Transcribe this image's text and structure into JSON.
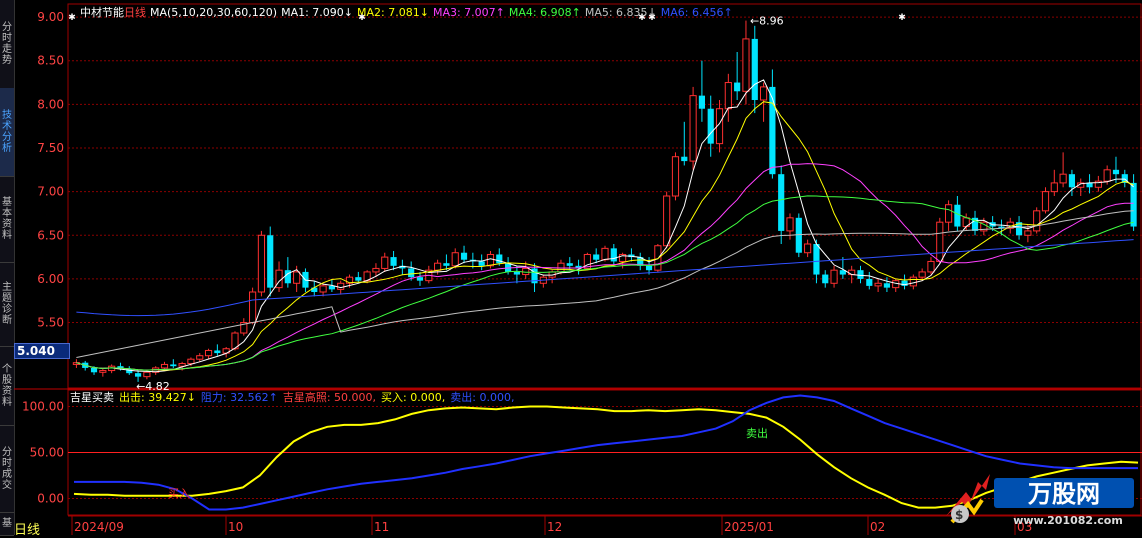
{
  "sidebar": {
    "tabs": [
      {
        "label": "分时走势",
        "active": false
      },
      {
        "label": "技术分析",
        "active": true
      },
      {
        "label": "基本资料",
        "active": false
      },
      {
        "label": "主题诊断",
        "active": false
      },
      {
        "label": "个股资料",
        "active": false
      },
      {
        "label": "分时成交",
        "active": false
      },
      {
        "label": "基",
        "active": false
      }
    ]
  },
  "header": {
    "stock_name": "中材节能",
    "period": "日线",
    "ma_params": "MA(5,10,20,30,60,120)",
    "mas": [
      {
        "label": "MA1:",
        "value": "7.090",
        "arrow": "↓",
        "color": "#ffffff"
      },
      {
        "label": "MA2:",
        "value": "7.081",
        "arrow": "↓",
        "color": "#ffff00"
      },
      {
        "label": "MA3:",
        "value": "7.007",
        "arrow": "↑",
        "color": "#ff40ff"
      },
      {
        "label": "MA4:",
        "value": "6.908",
        "arrow": "↑",
        "color": "#40ff40"
      },
      {
        "label": "MA5:",
        "value": "6.835",
        "arrow": "↓",
        "color": "#c0c0c0"
      },
      {
        "label": "MA6:",
        "value": "6.456",
        "arrow": "↑",
        "color": "#3050ff"
      }
    ]
  },
  "price_axis": {
    "ticks": [
      "9.00",
      "8.50",
      "8.00",
      "7.50",
      "7.00",
      "6.50",
      "6.00",
      "5.50"
    ],
    "current_price": "5.040"
  },
  "annotations": {
    "high": "8.96",
    "low": "4.82"
  },
  "indicator": {
    "name": "吉星买卖",
    "fields": [
      {
        "label": "出击:",
        "value": "39.427",
        "arrow": "↓",
        "color": "#ffff00"
      },
      {
        "label": "阻力:",
        "value": "32.562",
        "arrow": "↑",
        "color": "#3050ff"
      },
      {
        "label": "吉星高照:",
        "value": "50.000,",
        "arrow": "",
        "color": "#ff4040"
      },
      {
        "label": "买入:",
        "value": "0.000,",
        "arrow": "",
        "color": "#ffff00"
      },
      {
        "label": "卖出:",
        "value": "0.000,",
        "arrow": "",
        "color": "#3050ff"
      }
    ],
    "ticks": [
      "100.00",
      "50.00",
      "0.00"
    ],
    "buy_label": "买入",
    "sell_label": "卖出"
  },
  "time_axis": {
    "labels": [
      "2024/09",
      "10",
      "11",
      "12",
      "2025/01",
      "02",
      "03"
    ]
  },
  "bottom_tab": "日线",
  "watermark": {
    "brand": "万股网",
    "url": "www.201082.com"
  },
  "colors": {
    "up": "#ff3030",
    "down": "#00e5ff",
    "grid": "#8b0000"
  },
  "chart_data": {
    "type": "candlestick",
    "price_range": [
      4.75,
      9.15
    ],
    "candles": [
      [
        5.02,
        5.08,
        4.98,
        5.04
      ],
      [
        5.04,
        5.06,
        4.95,
        4.98
      ],
      [
        4.98,
        5.0,
        4.9,
        4.93
      ],
      [
        4.93,
        4.97,
        4.88,
        4.95
      ],
      [
        4.95,
        5.02,
        4.92,
        5.0
      ],
      [
        5.0,
        5.04,
        4.95,
        4.97
      ],
      [
        4.97,
        5.0,
        4.9,
        4.92
      ],
      [
        4.92,
        4.95,
        4.82,
        4.88
      ],
      [
        4.88,
        4.95,
        4.85,
        4.93
      ],
      [
        4.93,
        5.0,
        4.9,
        4.98
      ],
      [
        4.98,
        5.05,
        4.95,
        5.02
      ],
      [
        5.02,
        5.08,
        4.98,
        5.0
      ],
      [
        5.0,
        5.05,
        4.95,
        5.03
      ],
      [
        5.03,
        5.1,
        5.0,
        5.08
      ],
      [
        5.08,
        5.15,
        5.05,
        5.12
      ],
      [
        5.12,
        5.2,
        5.08,
        5.18
      ],
      [
        5.18,
        5.25,
        5.12,
        5.15
      ],
      [
        5.15,
        5.22,
        5.1,
        5.2
      ],
      [
        5.2,
        5.4,
        5.18,
        5.38
      ],
      [
        5.38,
        5.55,
        5.35,
        5.5
      ],
      [
        5.5,
        5.9,
        5.48,
        5.85
      ],
      [
        5.85,
        6.55,
        5.8,
        6.5
      ],
      [
        6.5,
        6.6,
        5.8,
        5.9
      ],
      [
        5.9,
        6.2,
        5.85,
        6.1
      ],
      [
        6.1,
        6.25,
        5.9,
        5.95
      ],
      [
        5.95,
        6.15,
        5.85,
        6.08
      ],
      [
        6.08,
        6.12,
        5.85,
        5.9
      ],
      [
        5.9,
        5.98,
        5.8,
        5.85
      ],
      [
        5.85,
        5.95,
        5.8,
        5.92
      ],
      [
        5.92,
        6.0,
        5.85,
        5.88
      ],
      [
        5.88,
        5.98,
        5.82,
        5.95
      ],
      [
        5.95,
        6.05,
        5.9,
        6.02
      ],
      [
        6.02,
        6.08,
        5.95,
        5.98
      ],
      [
        5.98,
        6.1,
        5.95,
        6.08
      ],
      [
        6.08,
        6.18,
        6.02,
        6.12
      ],
      [
        6.12,
        6.3,
        6.08,
        6.25
      ],
      [
        6.25,
        6.32,
        6.1,
        6.15
      ],
      [
        6.15,
        6.22,
        6.05,
        6.12
      ],
      [
        6.12,
        6.2,
        5.98,
        6.02
      ],
      [
        6.02,
        6.08,
        5.92,
        5.98
      ],
      [
        5.98,
        6.15,
        5.95,
        6.1
      ],
      [
        6.1,
        6.22,
        6.05,
        6.18
      ],
      [
        6.18,
        6.28,
        6.1,
        6.15
      ],
      [
        6.15,
        6.35,
        6.12,
        6.3
      ],
      [
        6.3,
        6.38,
        6.18,
        6.22
      ],
      [
        6.22,
        6.3,
        6.12,
        6.2
      ],
      [
        6.2,
        6.28,
        6.1,
        6.15
      ],
      [
        6.15,
        6.32,
        6.12,
        6.28
      ],
      [
        6.28,
        6.35,
        6.15,
        6.18
      ],
      [
        6.18,
        6.25,
        6.05,
        6.08
      ],
      [
        6.08,
        6.15,
        5.95,
        6.05
      ],
      [
        6.05,
        6.2,
        6.0,
        6.12
      ],
      [
        6.12,
        6.18,
        5.85,
        5.95
      ],
      [
        5.95,
        6.05,
        5.9,
        6.02
      ],
      [
        6.02,
        6.1,
        5.95,
        6.08
      ],
      [
        6.08,
        6.22,
        6.05,
        6.18
      ],
      [
        6.18,
        6.25,
        6.1,
        6.15
      ],
      [
        6.15,
        6.22,
        6.05,
        6.12
      ],
      [
        6.12,
        6.3,
        6.1,
        6.28
      ],
      [
        6.28,
        6.35,
        6.18,
        6.22
      ],
      [
        6.22,
        6.38,
        6.2,
        6.35
      ],
      [
        6.35,
        6.4,
        6.15,
        6.2
      ],
      [
        6.2,
        6.3,
        6.12,
        6.28
      ],
      [
        6.28,
        6.35,
        6.2,
        6.25
      ],
      [
        6.25,
        6.3,
        6.1,
        6.15
      ],
      [
        6.15,
        6.25,
        6.05,
        6.1
      ],
      [
        6.1,
        6.4,
        6.08,
        6.38
      ],
      [
        6.38,
        7.0,
        6.35,
        6.95
      ],
      [
        6.95,
        7.45,
        6.9,
        7.4
      ],
      [
        7.4,
        7.8,
        7.3,
        7.35
      ],
      [
        7.35,
        8.2,
        7.25,
        8.1
      ],
      [
        8.1,
        8.5,
        7.8,
        7.95
      ],
      [
        7.95,
        8.1,
        7.4,
        7.55
      ],
      [
        7.55,
        8.05,
        7.45,
        7.95
      ],
      [
        7.95,
        8.35,
        7.8,
        8.25
      ],
      [
        8.25,
        8.6,
        8.05,
        8.15
      ],
      [
        8.15,
        8.96,
        8.0,
        8.75
      ],
      [
        8.75,
        8.9,
        7.9,
        8.05
      ],
      [
        8.05,
        8.25,
        7.8,
        8.2
      ],
      [
        8.2,
        8.4,
        7.15,
        7.2
      ],
      [
        7.2,
        7.3,
        6.4,
        6.55
      ],
      [
        6.55,
        6.75,
        6.45,
        6.7
      ],
      [
        6.7,
        6.75,
        6.25,
        6.3
      ],
      [
        6.3,
        6.45,
        6.25,
        6.4
      ],
      [
        6.4,
        6.45,
        5.95,
        6.05
      ],
      [
        6.05,
        6.1,
        5.9,
        5.95
      ],
      [
        5.95,
        6.15,
        5.9,
        6.1
      ],
      [
        6.1,
        6.25,
        6.0,
        6.05
      ],
      [
        6.05,
        6.15,
        5.95,
        6.1
      ],
      [
        6.1,
        6.15,
        5.95,
        6.0
      ],
      [
        6.0,
        6.08,
        5.88,
        5.92
      ],
      [
        5.92,
        6.0,
        5.85,
        5.95
      ],
      [
        5.95,
        6.02,
        5.85,
        5.9
      ],
      [
        5.9,
        6.0,
        5.85,
        5.98
      ],
      [
        5.98,
        6.05,
        5.88,
        5.92
      ],
      [
        5.92,
        6.05,
        5.88,
        6.02
      ],
      [
        6.02,
        6.12,
        5.98,
        6.08
      ],
      [
        6.08,
        6.25,
        6.05,
        6.2
      ],
      [
        6.2,
        6.7,
        6.18,
        6.65
      ],
      [
        6.65,
        6.9,
        6.55,
        6.85
      ],
      [
        6.85,
        6.95,
        6.55,
        6.6
      ],
      [
        6.6,
        6.75,
        6.55,
        6.7
      ],
      [
        6.7,
        6.78,
        6.5,
        6.55
      ],
      [
        6.55,
        6.7,
        6.5,
        6.65
      ],
      [
        6.65,
        6.72,
        6.55,
        6.6
      ],
      [
        6.6,
        6.68,
        6.5,
        6.58
      ],
      [
        6.58,
        6.7,
        6.52,
        6.65
      ],
      [
        6.65,
        6.72,
        6.45,
        6.5
      ],
      [
        6.5,
        6.62,
        6.42,
        6.55
      ],
      [
        6.55,
        6.82,
        6.52,
        6.78
      ],
      [
        6.78,
        7.05,
        6.75,
        7.0
      ],
      [
        7.0,
        7.25,
        6.95,
        7.1
      ],
      [
        7.1,
        7.45,
        7.05,
        7.2
      ],
      [
        7.2,
        7.25,
        6.95,
        7.05
      ],
      [
        7.05,
        7.15,
        6.95,
        7.1
      ],
      [
        7.1,
        7.2,
        6.98,
        7.05
      ],
      [
        7.05,
        7.18,
        7.0,
        7.12
      ],
      [
        7.12,
        7.3,
        7.08,
        7.25
      ],
      [
        7.25,
        7.4,
        7.1,
        7.2
      ],
      [
        7.2,
        7.25,
        7.05,
        7.1
      ],
      [
        7.1,
        7.2,
        6.55,
        6.6
      ]
    ],
    "indicator_range": [
      -18,
      118
    ],
    "attack": [
      5,
      4,
      4,
      3,
      3,
      3,
      3,
      3,
      5,
      8,
      12,
      25,
      45,
      62,
      72,
      78,
      80,
      80,
      82,
      86,
      92,
      96,
      98,
      99,
      98,
      97,
      99,
      100,
      100,
      99,
      98,
      97,
      95,
      95,
      96,
      95,
      96,
      97,
      96,
      94,
      92,
      88,
      78,
      64,
      48,
      34,
      22,
      12,
      4,
      -5,
      -10,
      -10,
      -8,
      -2,
      6,
      12,
      18,
      24,
      28,
      32,
      36,
      38,
      40,
      39
    ],
    "resist": [
      18,
      18,
      18,
      18,
      17,
      15,
      10,
      0,
      -12,
      -12,
      -10,
      -6,
      -2,
      2,
      6,
      10,
      13,
      16,
      18,
      20,
      22,
      25,
      28,
      32,
      35,
      38,
      42,
      46,
      49,
      52,
      55,
      58,
      60,
      62,
      64,
      66,
      68,
      72,
      76,
      84,
      96,
      104,
      110,
      112,
      110,
      106,
      98,
      90,
      82,
      76,
      70,
      64,
      58,
      52,
      46,
      42,
      38,
      36,
      34,
      33,
      33,
      33,
      33,
      33
    ]
  }
}
